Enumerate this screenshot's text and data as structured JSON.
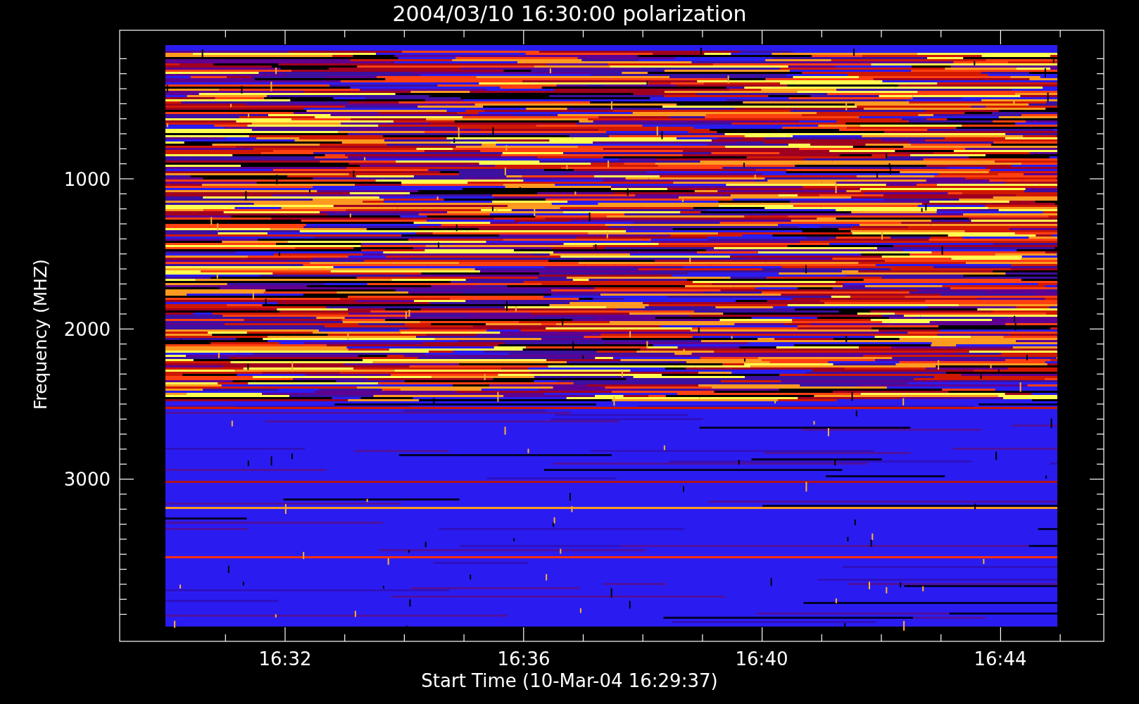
{
  "plot": {
    "title": "2004/03/10 16:30:00 polarization",
    "y_axis": {
      "label": "Frequency (MHZ)",
      "tick_labels": [
        "1000",
        "2000",
        "3000"
      ]
    },
    "x_axis": {
      "label": "Start Time (10-Mar-04 16:29:37)",
      "tick_labels": [
        "16:32",
        "16:36",
        "16:40",
        "16:44"
      ]
    }
  }
}
